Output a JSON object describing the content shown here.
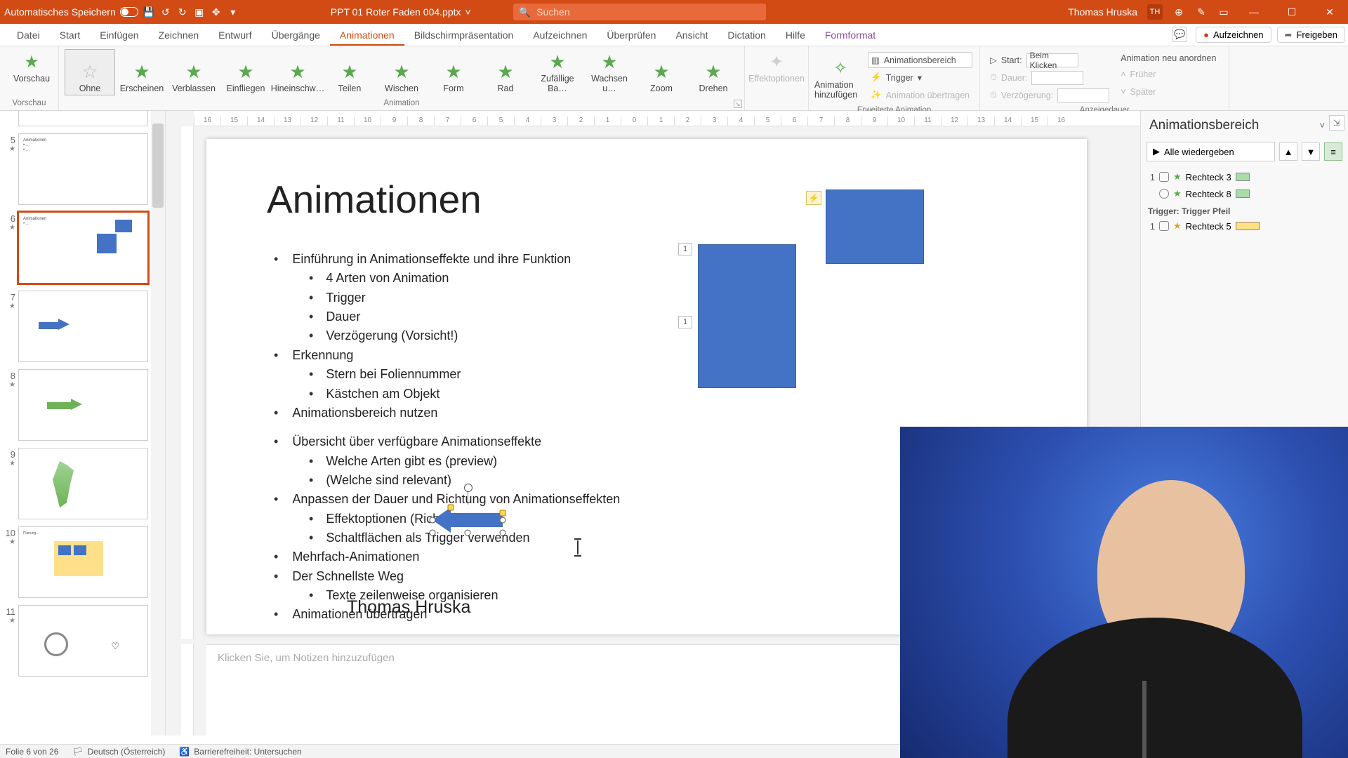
{
  "titlebar": {
    "autosave_label": "Automatisches Speichern",
    "filename": "PPT 01 Roter Faden 004.pptx",
    "search_placeholder": "Suchen",
    "user_name": "Thomas Hruska",
    "user_initials": "TH"
  },
  "menus": {
    "tabs": [
      "Datei",
      "Start",
      "Einfügen",
      "Zeichnen",
      "Entwurf",
      "Übergänge",
      "Animationen",
      "Bildschirmpräsentation",
      "Aufzeichnen",
      "Überprüfen",
      "Ansicht",
      "Dictation",
      "Hilfe",
      "Formformat"
    ],
    "active_index": 6,
    "record": "Aufzeichnen",
    "share": "Freigeben"
  },
  "ribbon": {
    "preview": "Vorschau",
    "preview_group": "Vorschau",
    "gallery": [
      "Ohne",
      "Erscheinen",
      "Verblassen",
      "Einfliegen",
      "Hineinschw…",
      "Teilen",
      "Wischen",
      "Form",
      "Rad",
      "Zufällige Ba…",
      "Wachsen u…",
      "Zoom",
      "Drehen"
    ],
    "gallery_sel": 0,
    "animation_group": "Animation",
    "effect_options": "Effektoptionen",
    "add_anim": "Animation hinzufügen",
    "adv_group": "Erweiterte Animation",
    "anim_pane": "Animationsbereich",
    "trigger": "Trigger",
    "painter": "Animation übertragen",
    "timing_group": "Anzeigedauer",
    "start": "Start:",
    "start_val": "Beim Klicken",
    "duration": "Dauer:",
    "delay": "Verzögerung:",
    "reorder": "Animation neu anordnen",
    "earlier": "Früher",
    "later": "Später"
  },
  "thumbs": {
    "start": 5,
    "items": [
      {
        "n": "5",
        "star": true
      },
      {
        "n": "6",
        "star": true,
        "sel": true
      },
      {
        "n": "7",
        "star": true
      },
      {
        "n": "8",
        "star": true
      },
      {
        "n": "9",
        "star": true
      },
      {
        "n": "10",
        "star": true
      },
      {
        "n": "11",
        "star": true
      }
    ]
  },
  "slide": {
    "title": "Animationen",
    "bullets": [
      {
        "lvl": 1,
        "t": "Einführung in Animationseffekte und ihre Funktion"
      },
      {
        "lvl": 2,
        "t": "4 Arten von Animation"
      },
      {
        "lvl": 2,
        "t": "Trigger"
      },
      {
        "lvl": 2,
        "t": "Dauer"
      },
      {
        "lvl": 2,
        "t": "Verzögerung (Vorsicht!)"
      },
      {
        "lvl": 1,
        "t": "Erkennung"
      },
      {
        "lvl": 2,
        "t": "Stern bei Foliennummer"
      },
      {
        "lvl": 2,
        "t": "Kästchen am Objekt"
      },
      {
        "lvl": 1,
        "t": "Animationsbereich nutzen"
      },
      {
        "lvl": 0,
        "t": ""
      },
      {
        "lvl": 1,
        "t": "Übersicht über verfügbare Animationseffekte"
      },
      {
        "lvl": 2,
        "t": "Welche Arten gibt es (preview)"
      },
      {
        "lvl": 2,
        "t": "(Welche sind relevant)"
      },
      {
        "lvl": 1,
        "t": "Anpassen der Dauer und Richtung von Animationseffekten"
      },
      {
        "lvl": 2,
        "t": "Effektoptionen (Richtung)"
      },
      {
        "lvl": 2,
        "t": "Schaltflächen als Trigger verwenden"
      },
      {
        "lvl": 1,
        "t": "Mehrfach-Animationen"
      },
      {
        "lvl": 1,
        "t": "Der Schnellste Weg"
      },
      {
        "lvl": 2,
        "t": "Texte zeilenweise organisieren"
      },
      {
        "lvl": 1,
        "t": "Animationen übertragen"
      }
    ],
    "author": "Thomas Hruska",
    "tags": [
      "1",
      "1"
    ]
  },
  "notes": {
    "placeholder": "Klicken Sie, um Notizen hinzuzufügen"
  },
  "panel": {
    "title": "Animationsbereich",
    "play_all": "Alle wiedergeben",
    "items": [
      {
        "n": "1",
        "icon": "mouse",
        "fx": "green",
        "name": "Rechteck 3",
        "bar": "g"
      },
      {
        "n": "",
        "icon": "clock",
        "fx": "green",
        "name": "Rechteck 8",
        "bar": "g"
      }
    ],
    "trigger_hdr": "Trigger: Trigger Pfeil",
    "trigger_items": [
      {
        "n": "1",
        "icon": "mouse",
        "fx": "yellow",
        "name": "Rechteck 5",
        "bar": "y"
      }
    ]
  },
  "status": {
    "slide": "Folie 6 von 26",
    "lang": "Deutsch (Österreich)",
    "access": "Barrierefreiheit: Untersuchen"
  },
  "ruler_ticks": [
    "16",
    "15",
    "14",
    "13",
    "12",
    "11",
    "10",
    "9",
    "8",
    "7",
    "6",
    "5",
    "4",
    "3",
    "2",
    "1",
    "0",
    "1",
    "2",
    "3",
    "4",
    "5",
    "6",
    "7",
    "8",
    "9",
    "10",
    "11",
    "12",
    "13",
    "14",
    "15",
    "16"
  ]
}
